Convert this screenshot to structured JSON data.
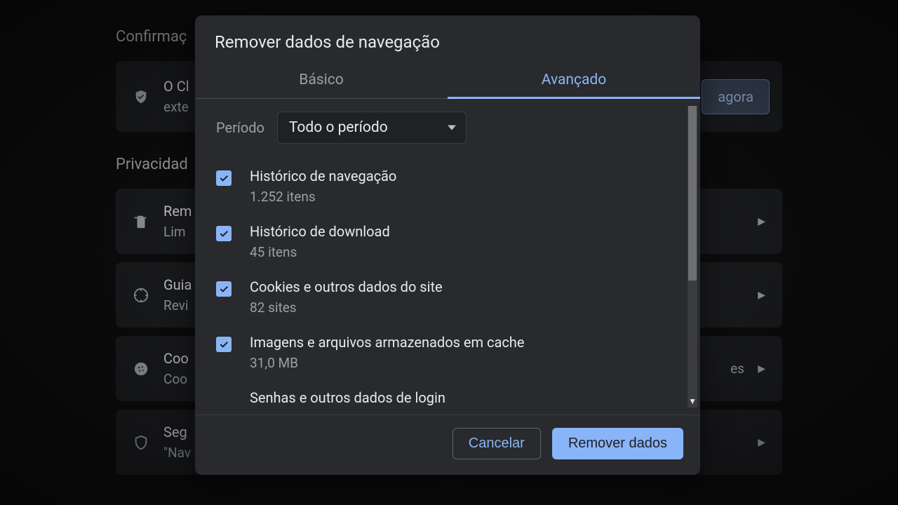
{
  "background": {
    "section1_title": "Confirmaç",
    "card1_line1": "O Cl",
    "card1_line2": "exte",
    "card1_button": "agora",
    "section2_title": "Privacidad",
    "rows": [
      {
        "line1": "Rem",
        "line2": "Lim"
      },
      {
        "line1": "Guia",
        "line2": "Revi"
      },
      {
        "line1": "Coo",
        "line2": "Coo"
      },
      {
        "line1": "Seg",
        "line2": "\"Nav"
      }
    ],
    "row_suffix": "es"
  },
  "modal": {
    "title": "Remover dados de navegação",
    "tabs": {
      "basic": "Básico",
      "advanced": "Avançado"
    },
    "period": {
      "label": "Período",
      "selected": "Todo o período"
    },
    "items": [
      {
        "title": "Histórico de navegação",
        "sub": "1.252 itens",
        "checked": true
      },
      {
        "title": "Histórico de download",
        "sub": "45 itens",
        "checked": true
      },
      {
        "title": "Cookies e outros dados do site",
        "sub": "82 sites",
        "checked": true
      },
      {
        "title": "Imagens e arquivos armazenados em cache",
        "sub": "31,0 MB",
        "checked": true
      },
      {
        "title": "Senhas e outros dados de login",
        "sub": "",
        "checked": false
      }
    ],
    "buttons": {
      "cancel": "Cancelar",
      "confirm": "Remover dados"
    }
  }
}
